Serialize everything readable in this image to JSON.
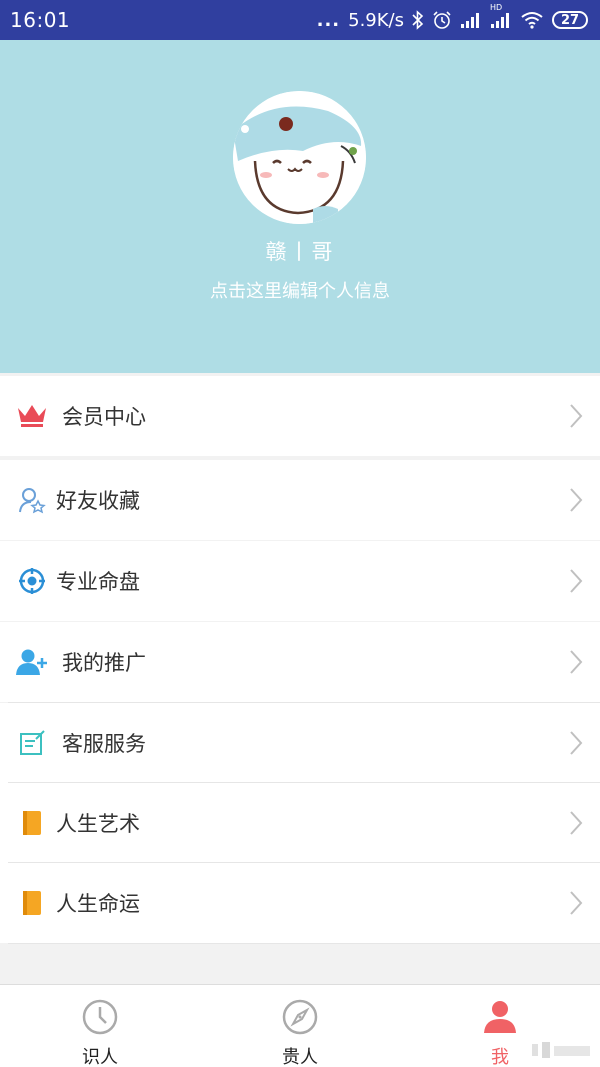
{
  "status_bar": {
    "time": "16:01",
    "dots": "...",
    "network_speed": "5.9K/s",
    "hd_label": "HD",
    "battery": "27"
  },
  "profile": {
    "username": "赣丨哥",
    "edit_hint": "点击这里编辑个人信息"
  },
  "menu": {
    "items": [
      {
        "label": "会员中心",
        "icon": "crown-icon",
        "color": "#e94b57"
      },
      {
        "label": "好友收藏",
        "icon": "user-star-icon",
        "color": "#6aa0d8"
      },
      {
        "label": "专业命盘",
        "icon": "target-icon",
        "color": "#2b8fd6"
      },
      {
        "label": "我的推广",
        "icon": "add-user-icon",
        "color": "#3ba7e6"
      },
      {
        "label": "客服服务",
        "icon": "edit-note-icon",
        "color": "#3cc0c0"
      },
      {
        "label": "人生艺术",
        "icon": "book-icon",
        "color": "#f5a623"
      },
      {
        "label": "人生命运",
        "icon": "book-icon",
        "color": "#f5a623"
      }
    ]
  },
  "tabs": [
    {
      "label": "识人",
      "icon": "clock-icon",
      "active": false
    },
    {
      "label": "贵人",
      "icon": "compass-icon",
      "active": false
    },
    {
      "label": "我",
      "icon": "person-icon",
      "active": true
    }
  ],
  "colors": {
    "status_bar": "#303f9f",
    "header_bg": "#afdde5",
    "active_tab": "#f06265"
  }
}
